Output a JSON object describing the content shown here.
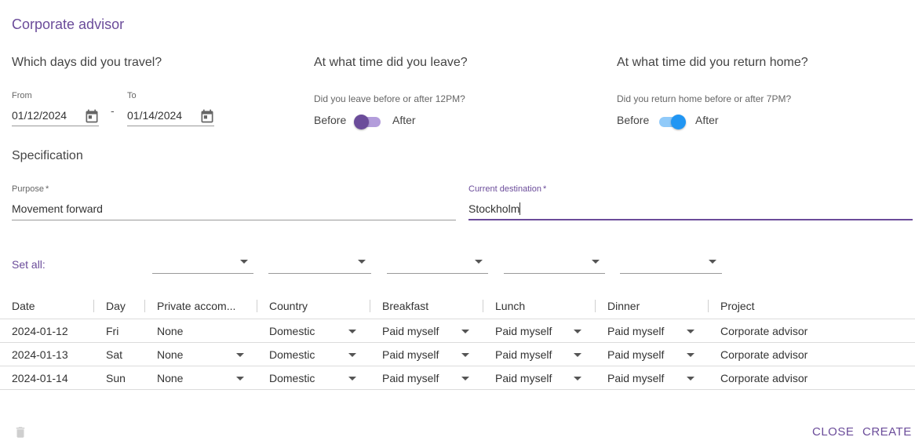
{
  "app": {
    "title": "Corporate advisor"
  },
  "travel": {
    "heading": "Which days did you travel?",
    "from_label": "From",
    "from_value": "01/12/2024",
    "to_label": "To",
    "to_value": "01/14/2024",
    "separator": "-"
  },
  "leave": {
    "heading": "At what time did you leave?",
    "question": "Did you leave before or after 12PM?",
    "before_label": "Before",
    "after_label": "After",
    "toggle_on": false,
    "accent": "#6b4c9a"
  },
  "return_home": {
    "heading": "At what time did you return home?",
    "question": "Did you return home before or after 7PM?",
    "before_label": "Before",
    "after_label": "After",
    "toggle_on": true,
    "accent": "#2196f3"
  },
  "specification": {
    "heading": "Specification",
    "purpose_label": "Purpose",
    "purpose_value": "Movement forward",
    "destination_label": "Current destination",
    "destination_value": "Stockholm",
    "required_mark": "*"
  },
  "set_all": {
    "label": "Set all:"
  },
  "table": {
    "columns": [
      "Date",
      "Day",
      "Private accom...",
      "Country",
      "Breakfast",
      "Lunch",
      "Dinner",
      "Project"
    ],
    "rows": [
      {
        "date": "2024-01-12",
        "day": "Fri",
        "accommodation": "None",
        "country": "Domestic",
        "breakfast": "Paid myself",
        "lunch": "Paid myself",
        "dinner": "Paid myself",
        "project": "Corporate advisor"
      },
      {
        "date": "2024-01-13",
        "day": "Sat",
        "accommodation": "None",
        "country": "Domestic",
        "breakfast": "Paid myself",
        "lunch": "Paid myself",
        "dinner": "Paid myself",
        "project": "Corporate advisor"
      },
      {
        "date": "2024-01-14",
        "day": "Sun",
        "accommodation": "None",
        "country": "Domestic",
        "breakfast": "Paid myself",
        "lunch": "Paid myself",
        "dinner": "Paid myself",
        "project": "Corporate advisor"
      }
    ]
  },
  "footer": {
    "close_label": "CLOSE",
    "create_label": "CREATE"
  },
  "colors": {
    "brand": "#6b4c9a",
    "toggle_blue": "#2196f3"
  }
}
